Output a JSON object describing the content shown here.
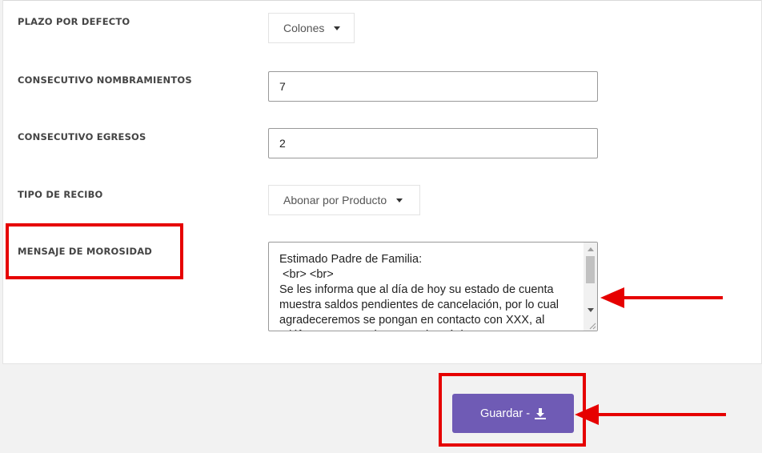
{
  "form": {
    "plazo": {
      "label": "PLAZO POR DEFECTO",
      "value": "Colones"
    },
    "nombramientos": {
      "label": "CONSECUTIVO NOMBRAMIENTOS",
      "value": "7"
    },
    "egresos": {
      "label": "CONSECUTIVO EGRESOS",
      "value": "2"
    },
    "tipo_recibo": {
      "label": "TIPO DE RECIBO",
      "value": "Abonar por Producto"
    },
    "morosidad": {
      "label": "MENSAJE DE MOROSIDAD",
      "value": "Estimado Padre de Familia:\n <br> <br>\nSe les informa que al día de hoy su estado de cuenta muestra saldos pendientes de cancelación, por lo cual agradeceremos se pongan en contacto con XXX, al teléfono XXXX o al  correo electrónico XXX"
    }
  },
  "actions": {
    "save_label": "Guardar -",
    "save_icon": "download-icon"
  },
  "annotations": {
    "color": "#e60000"
  },
  "colors": {
    "button": "#6f5bb5"
  }
}
